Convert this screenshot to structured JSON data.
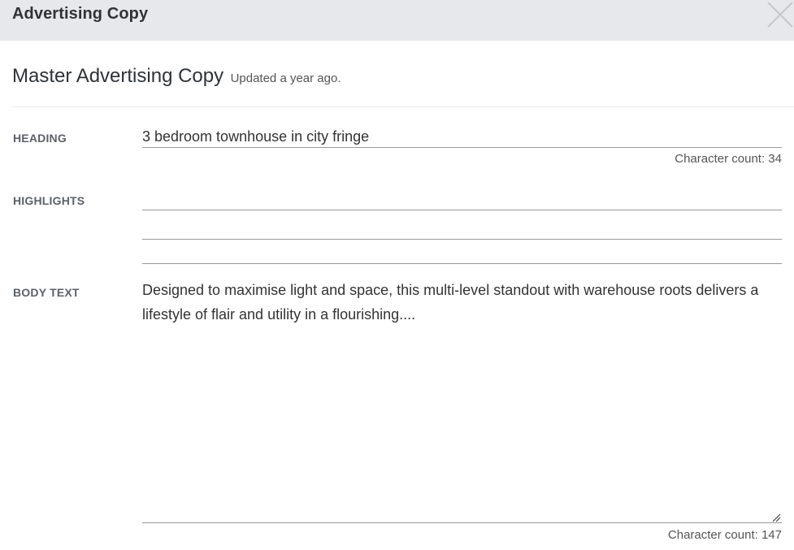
{
  "modal": {
    "title": "Advertising Copy",
    "close_icon": "close-icon"
  },
  "section": {
    "title": "Master Advertising Copy",
    "updated": "Updated a year ago."
  },
  "heading": {
    "label": "HEADING",
    "value": "3 bedroom townhouse in city fringe",
    "char_count": "Character count: 34"
  },
  "highlights": {
    "label": "HIGHLIGHTS",
    "values": [
      "",
      "",
      ""
    ]
  },
  "body_text": {
    "label": "BODY TEXT",
    "value": "Designed to maximise light and space, this multi-level standout with warehouse roots delivers a lifestyle of flair and utility in a flourishing....",
    "char_count": "Character count: 147",
    "resize_icon": "resize-handle-icon"
  },
  "colors": {
    "header_bg": "#e6e8ec",
    "label_text": "#5d6167",
    "underline": "#9a9a9a"
  }
}
